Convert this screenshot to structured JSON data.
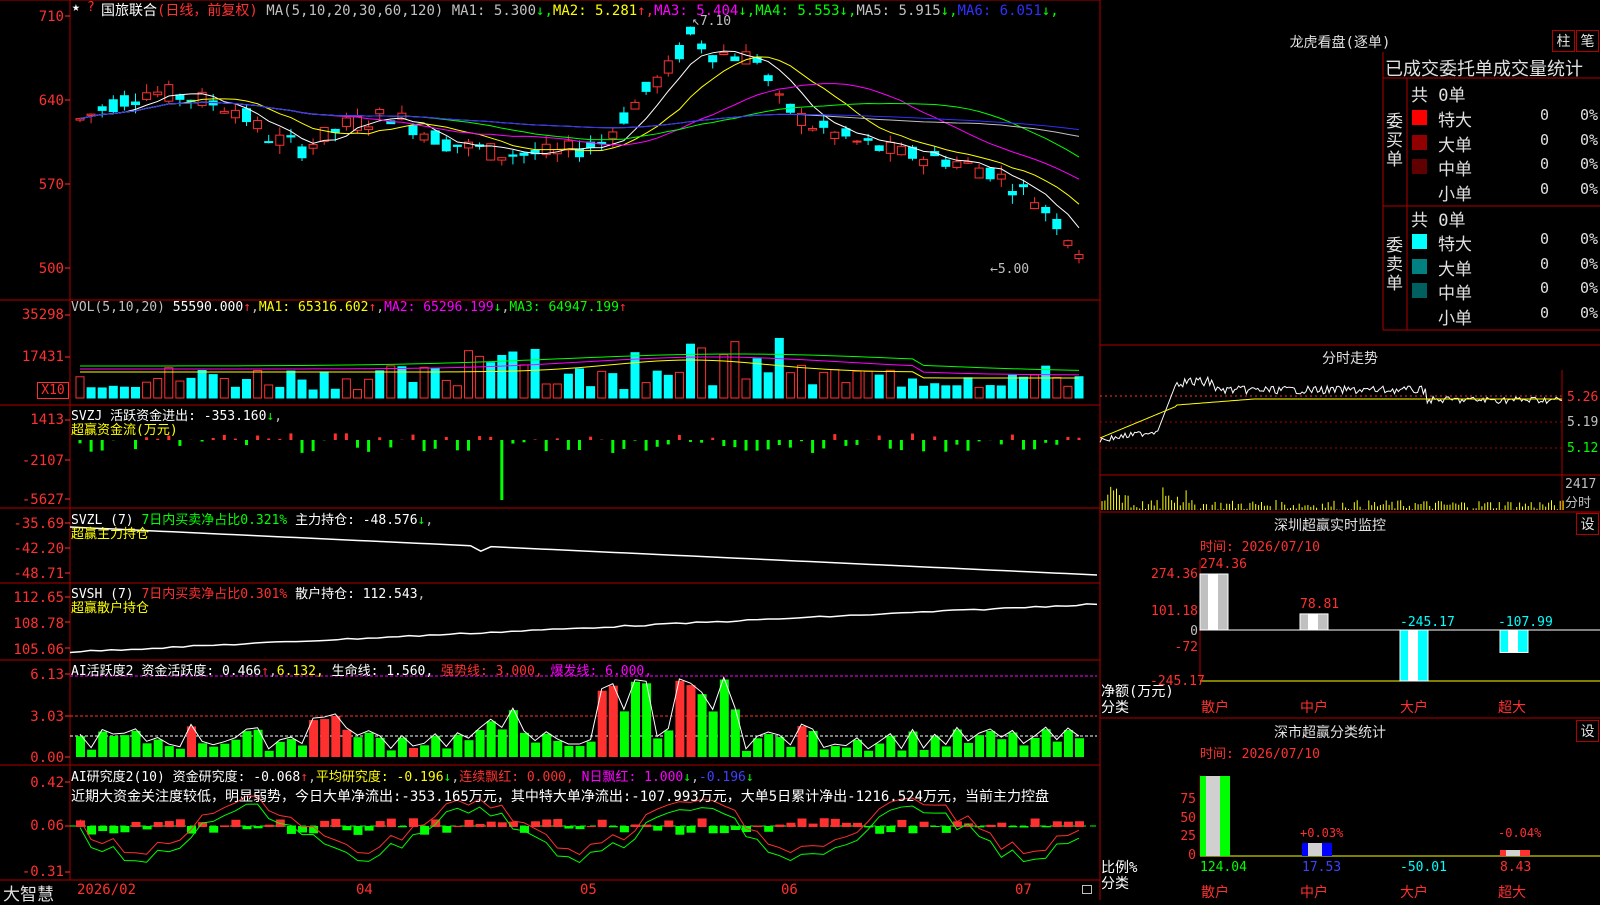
{
  "header": {
    "star": "★",
    "question": "?",
    "stock_name": "国旅联合",
    "mode": "(日线，前复权)",
    "ma_params": "MA(5,10,20,30,60,120)",
    "ma_items": [
      {
        "label": "MA1: 5.300",
        "arrow": "↓",
        "color": "#c0c0c0",
        "arrow_color": "#00ff00"
      },
      {
        "label": "MA2: 5.281",
        "arrow": "↑",
        "color": "#ffff00",
        "arrow_color": "#ff3030"
      },
      {
        "label": "MA3: 5.404",
        "arrow": "↓",
        "color": "#ff00ff",
        "arrow_color": "#00ff00"
      },
      {
        "label": "MA4: 5.553",
        "arrow": "↓",
        "color": "#00ff00",
        "arrow_color": "#00ff00"
      },
      {
        "label": "MA5: 5.915",
        "arrow": "↓",
        "color": "#c0c0c0",
        "arrow_color": "#00ff00"
      },
      {
        "label": "MA6: 6.051",
        "arrow": "↓",
        "color": "#3030ff",
        "arrow_color": "#00ff00"
      }
    ]
  },
  "price_axis": [
    "710",
    "640",
    "570",
    "500"
  ],
  "price_annotations": {
    "high": "7.10",
    "low": "5.00"
  },
  "vol_axis": [
    "35298",
    "17431",
    "X10"
  ],
  "vol_header": {
    "params": "VOL(5,10,20)",
    "val": "55590.000",
    "ma1": "MA1: 65316.602",
    "ma2": "MA2: 65296.199",
    "ma3": "MA3: 64947.199"
  },
  "svzj": {
    "axis": [
      "1413",
      "-2107",
      "-5627"
    ],
    "line1": "SVZJ  活跃资金进出: -353.160",
    "line2": "超赢资金流(万元)"
  },
  "svzl": {
    "axis": [
      "-35.69",
      "-42.20",
      "-48.71"
    ],
    "line1a": "SVZL (7)",
    "line1b": "7日内买卖净占比0.321%",
    "line1c": "主力持仓: -48.576",
    "line2": "超赢主力持仓"
  },
  "svsh": {
    "axis": [
      "112.65",
      "108.78",
      "105.06"
    ],
    "line1a": "SVSH (7)",
    "line1b": "7日内买卖净占比0.301%",
    "line1c": "散户持仓: 112.543",
    "line2": "超赢散户持仓"
  },
  "ai_active": {
    "axis": [
      "6.13",
      "3.03",
      "0.00"
    ],
    "name": "AI活跃度2",
    "a": "资金活跃度: 0.466",
    "b": "6.132,",
    "c": "生命线: 1.560,",
    "d": "强势线: 3.000,",
    "e": "爆发线: 6.000,"
  },
  "ai_research": {
    "axis": [
      "0.42",
      "0.06",
      "-0.31"
    ],
    "name": "AI研究度2(10)",
    "a": "资金研究度: -0.068",
    "b": "平均研究度: -0.196",
    "c": "连续飘红: 0.000,",
    "d": "N日飘红: 1.000",
    "e": "-0.196",
    "comment": "近期大资金关注度较低，明显弱势，今日大单净流出:-353.165万元，其中特大单净流出:-107.993万元，大单5日累计净出-1216.524万元，当前主力控盘"
  },
  "date_axis": {
    "brand": "大智慧",
    "labels": [
      "2026/02",
      "04",
      "05",
      "06",
      "07"
    ]
  },
  "lhb": {
    "title": "龙虎看盘(逐单)",
    "btn1": "柱",
    "btn2": "笔",
    "tabs": "已成交委托单成交量统计",
    "buy_label": "委买单",
    "sell_label": "委卖单",
    "buy_total": "共 0单",
    "sell_total": "共 0单",
    "buy_rows": [
      {
        "name": "特大",
        "count": "0",
        "pct": "0%",
        "color": "#ff0000"
      },
      {
        "name": "大单",
        "count": "0",
        "pct": "0%",
        "color": "#900000"
      },
      {
        "name": "中单",
        "count": "0",
        "pct": "0%",
        "color": "#600000"
      },
      {
        "name": "小单",
        "count": "0",
        "pct": "0%",
        "color": ""
      }
    ],
    "sell_rows": [
      {
        "name": "特大",
        "count": "0",
        "pct": "0%",
        "color": "#00ffff"
      },
      {
        "name": "大单",
        "count": "0",
        "pct": "0%",
        "color": "#008080"
      },
      {
        "name": "中单",
        "count": "0",
        "pct": "0%",
        "color": "#006060"
      },
      {
        "name": "小单",
        "count": "0",
        "pct": "0%",
        "color": ""
      }
    ]
  },
  "intraday": {
    "title": "分时走势",
    "axis": [
      "5.26",
      "5.19",
      "5.12"
    ],
    "vol_label": "2417",
    "vol_sub": "分时"
  },
  "sz_monitor": {
    "title": "深圳超赢实时监控",
    "btn": "设",
    "time": "时间: 2026/07/10",
    "axis": [
      "274.36",
      "101.18",
      "0",
      "-72",
      "-245.17"
    ],
    "ylabel1": "净额(万元)",
    "ylabel2": "分类",
    "categories": [
      "散户",
      "中户",
      "大户",
      "超大"
    ],
    "values": [
      274.36,
      78.81,
      -245.17,
      -107.99
    ],
    "value_labels": [
      "274.36",
      "78.81",
      "-245.17",
      "-107.99"
    ]
  },
  "sz_class": {
    "title": "深市超赢分类统计",
    "btn": "设",
    "time": "时间: 2026/07/10",
    "axis": [
      "75",
      "50",
      "25",
      "0"
    ],
    "ylabel1": "比例%",
    "ylabel2": "分类",
    "categories": [
      "散户",
      "中户",
      "大户",
      "超大"
    ],
    "values": [
      124.04,
      17.53,
      -50.01,
      8.43
    ],
    "value_labels": [
      "124.04",
      "17.53",
      "-50.01",
      "8.43"
    ],
    "pct_labels": [
      "",
      "+0.03%",
      "",
      "-0.04%"
    ]
  },
  "chart_data": [
    {
      "type": "candlestick",
      "title": "国旅联合(日线，前复权)",
      "x": [
        "2026/02",
        "04",
        "05",
        "06",
        "07"
      ],
      "ylim": [
        4.9,
        7.2
      ],
      "high": 7.1,
      "low": 5.0,
      "ma_latest": {
        "MA1": 5.3,
        "MA2": 5.281,
        "MA3": 5.404,
        "MA4": 5.553,
        "MA5": 5.915,
        "MA6": 6.051
      }
    },
    {
      "type": "bar",
      "title": "VOL(5,10,20)",
      "latest": 55590.0,
      "ma_latest": {
        "MA1": 65316.602,
        "MA2": 65296.199,
        "MA3": 64947.199
      }
    },
    {
      "type": "bar",
      "title": "深圳超赢实时监控",
      "categories": [
        "散户",
        "中户",
        "大户",
        "超大"
      ],
      "values": [
        274.36,
        78.81,
        -245.17,
        -107.99
      ],
      "ylabel": "净额(万元)"
    },
    {
      "type": "bar",
      "title": "深市超赢分类统计",
      "categories": [
        "散户",
        "中户",
        "大户",
        "超大"
      ],
      "values": [
        124.04,
        17.53,
        -50.01,
        8.43
      ],
      "ylabel": "比例%"
    }
  ]
}
